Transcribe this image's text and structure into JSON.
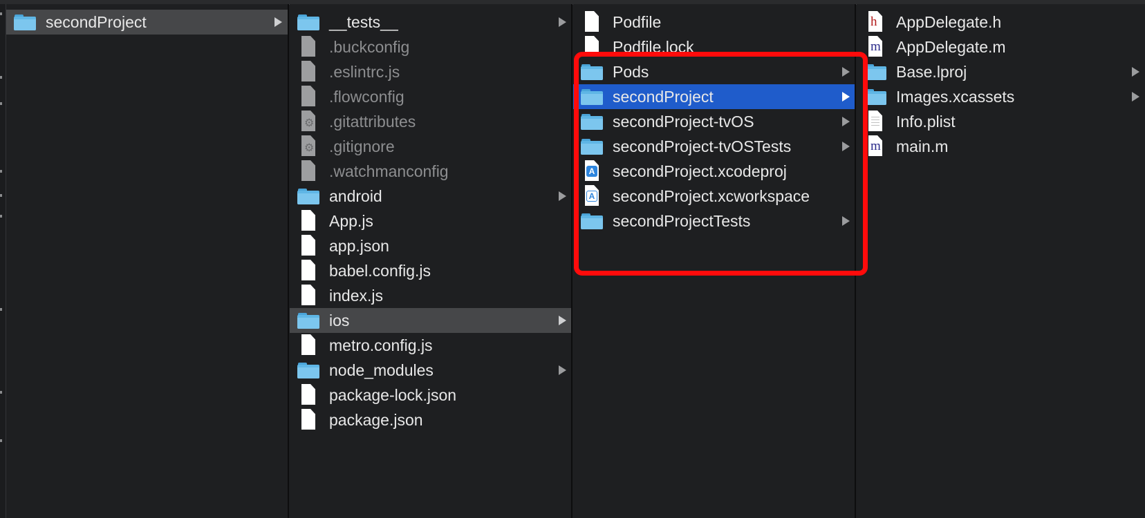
{
  "columns": [
    {
      "items": [
        {
          "name": "secondProject",
          "type": "folder",
          "arrow": true,
          "state": "gray"
        }
      ]
    },
    {
      "items": [
        {
          "name": "__tests__",
          "type": "folder",
          "arrow": true
        },
        {
          "name": ".buckconfig",
          "type": "doc-gray",
          "hidden": true
        },
        {
          "name": ".eslintrc.js",
          "type": "doc-gray",
          "hidden": true
        },
        {
          "name": ".flowconfig",
          "type": "doc-gray",
          "hidden": true
        },
        {
          "name": ".gitattributes",
          "type": "doc-gear",
          "hidden": true
        },
        {
          "name": ".gitignore",
          "type": "doc-gear",
          "hidden": true
        },
        {
          "name": ".watchmanconfig",
          "type": "doc-gray",
          "hidden": true
        },
        {
          "name": "android",
          "type": "folder",
          "arrow": true
        },
        {
          "name": "App.js",
          "type": "doc"
        },
        {
          "name": "app.json",
          "type": "doc"
        },
        {
          "name": "babel.config.js",
          "type": "doc"
        },
        {
          "name": "index.js",
          "type": "doc"
        },
        {
          "name": "ios",
          "type": "folder",
          "arrow": true,
          "state": "gray"
        },
        {
          "name": "metro.config.js",
          "type": "doc"
        },
        {
          "name": "node_modules",
          "type": "folder",
          "arrow": true
        },
        {
          "name": "package-lock.json",
          "type": "doc"
        },
        {
          "name": "package.json",
          "type": "doc"
        }
      ]
    },
    {
      "items": [
        {
          "name": "Podfile",
          "type": "doc"
        },
        {
          "name": "Podfile.lock",
          "type": "doc"
        },
        {
          "name": "Pods",
          "type": "folder",
          "arrow": true
        },
        {
          "name": "secondProject",
          "type": "folder",
          "arrow": true,
          "state": "blue"
        },
        {
          "name": "secondProject-tvOS",
          "type": "folder",
          "arrow": true
        },
        {
          "name": "secondProject-tvOSTests",
          "type": "folder",
          "arrow": true
        },
        {
          "name": "secondProject.xcodeproj",
          "type": "xcodeproj"
        },
        {
          "name": "secondProject.xcworkspace",
          "type": "xcworkspace"
        },
        {
          "name": "secondProjectTests",
          "type": "folder",
          "arrow": true
        }
      ]
    },
    {
      "items": [
        {
          "name": "AppDelegate.h",
          "type": "doc-h"
        },
        {
          "name": "AppDelegate.m",
          "type": "doc-m"
        },
        {
          "name": "Base.lproj",
          "type": "folder",
          "arrow": true
        },
        {
          "name": "Images.xcassets",
          "type": "folder",
          "arrow": true
        },
        {
          "name": "Info.plist",
          "type": "doc-plist"
        },
        {
          "name": "main.m",
          "type": "doc-m"
        }
      ]
    }
  ],
  "icons": {
    "folder": "folder-icon",
    "doc": "document-icon",
    "doc-gray": "document-icon",
    "doc-gear": "config-document-icon",
    "doc-h": "header-file-icon",
    "doc-m": "objc-source-file-icon",
    "doc-plist": "plist-file-icon",
    "xcodeproj": "xcode-project-icon",
    "xcworkspace": "xcode-workspace-icon"
  },
  "colors": {
    "selection_blue": "#1f5ccb",
    "selection_gray": "#464749",
    "annotation_red": "#ff0b0b",
    "folder_blue": "#5fb6e5"
  }
}
